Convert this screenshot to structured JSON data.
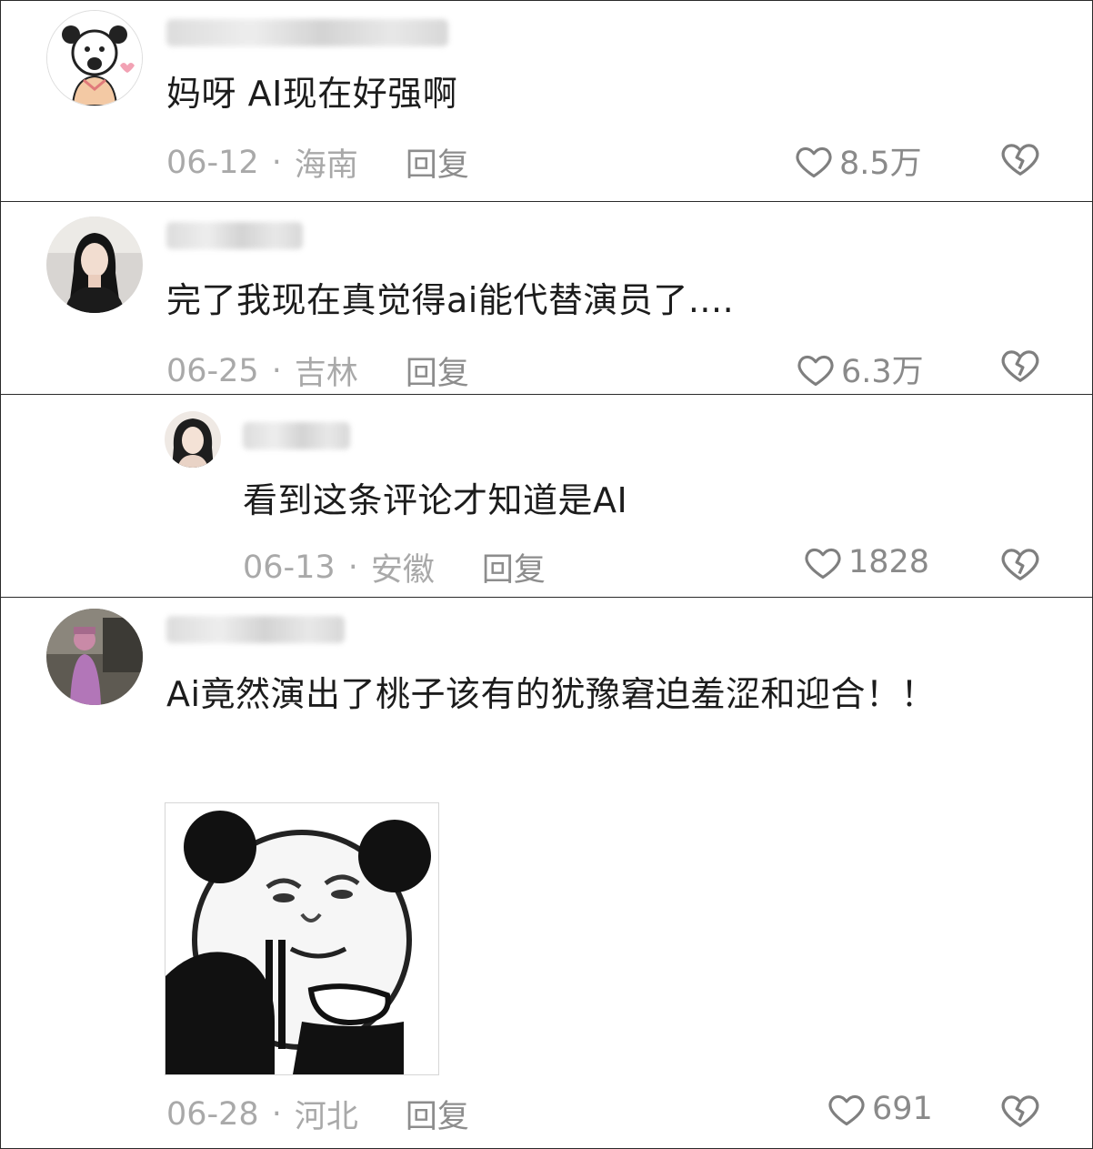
{
  "comments": [
    {
      "text": "妈呀 AI现在好强啊",
      "date": "06-12",
      "separator": "·",
      "location": "海南",
      "reply_label": "回复",
      "likes": "8.5万"
    },
    {
      "text": "完了我现在真觉得ai能代替演员了....",
      "date": "06-25",
      "separator": "·",
      "location": "吉林",
      "reply_label": "回复",
      "likes": "6.3万"
    },
    {
      "text": "看到这条评论才知道是AI",
      "date": "06-13",
      "separator": "·",
      "location": "安徽",
      "reply_label": "回复",
      "likes": "1828"
    },
    {
      "text": "Ai竟然演出了桃子该有的犹豫窘迫羞涩和迎合！！",
      "date": "06-28",
      "separator": "·",
      "location": "河北",
      "reply_label": "回复",
      "likes": "691"
    }
  ],
  "icons": {
    "like": "heart-outline-icon",
    "dislike": "broken-heart-icon"
  },
  "colors": {
    "text": "#1c1c1c",
    "meta": "#a9a9a9",
    "icon": "#7f7f7f",
    "divider": "#2a2a2a"
  }
}
